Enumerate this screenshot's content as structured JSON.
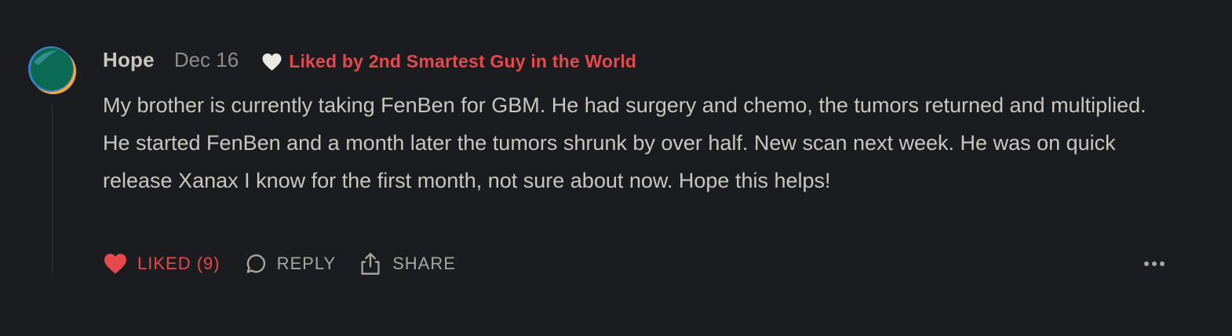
{
  "comment": {
    "author": "Hope",
    "date": "Dec 16",
    "liked_by": "Liked by 2nd Smartest Guy in the World",
    "body": "My brother is currently taking FenBen for GBM. He had surgery and chemo, the tumors returned and multiplied. He started FenBen and a month later the tumors shrunk by over half. New scan next week. He was on quick release Xanax I know for the first month, not sure about now. Hope this helps!",
    "avatar_colors": {
      "primary": "#0b6b52",
      "ring": "#f2a93b",
      "highlight": "#3b7fc9"
    }
  },
  "actions": {
    "like_label": "LIKED (9)",
    "reply_label": "REPLY",
    "share_label": "SHARE"
  },
  "icons": {
    "liked_by": "heart-icon",
    "like": "heart-filled-icon",
    "reply": "speech-bubble-icon",
    "share": "share-icon",
    "more": "ellipsis-icon"
  },
  "colors": {
    "background": "#1b1c1f",
    "text": "#c9c6c0",
    "muted": "#8f8c87",
    "accent": "#e5484d"
  }
}
